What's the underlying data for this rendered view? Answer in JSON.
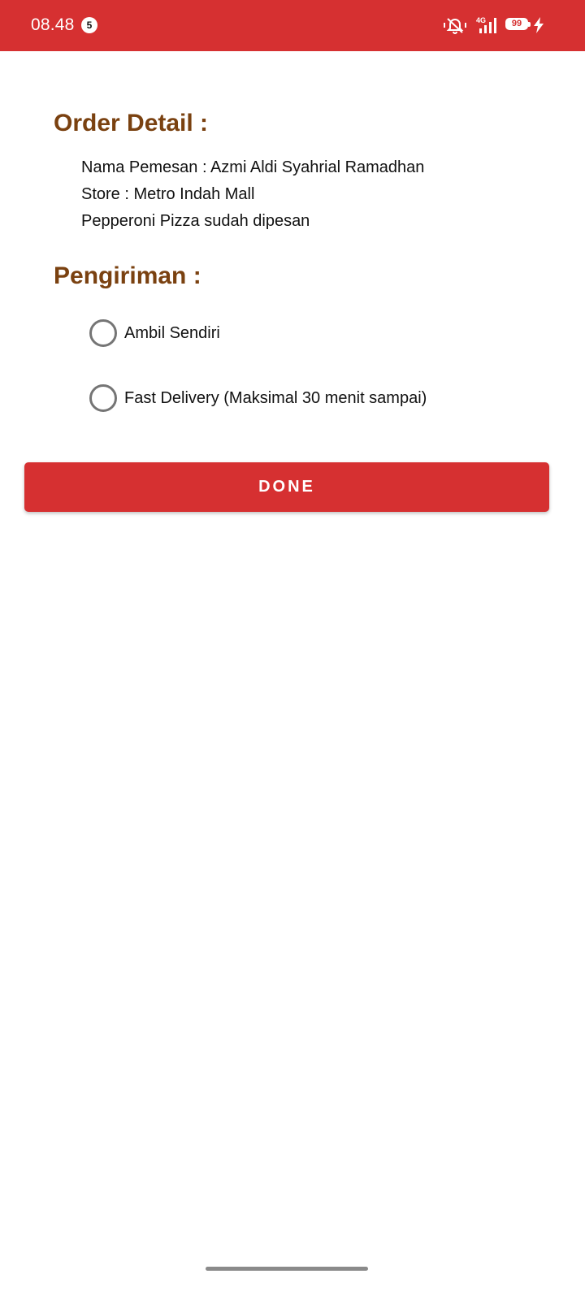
{
  "status_bar": {
    "time": "08.48",
    "notification_count": "5",
    "network_label": "4G",
    "battery_level": "99",
    "battery_fraction": 0.99,
    "icons": [
      "vibrate-mute-icon",
      "signal-icon",
      "battery-icon",
      "charging-icon"
    ]
  },
  "order_detail": {
    "title": "Order Detail :",
    "customer_line": "Nama Pemesan : Azmi Aldi Syahrial Ramadhan",
    "store_line": "Store : Metro Indah Mall",
    "item_line": "Pepperoni Pizza sudah dipesan"
  },
  "delivery": {
    "title": "Pengiriman :",
    "options": [
      {
        "label": "Ambil Sendiri",
        "selected": false
      },
      {
        "label": "Fast Delivery (Maksimal 30 menit sampai)",
        "selected": false
      }
    ]
  },
  "done_button": {
    "label": "DONE"
  },
  "colors": {
    "primary": "#d63031",
    "heading": "#7a4110",
    "radio_border": "#757575"
  }
}
